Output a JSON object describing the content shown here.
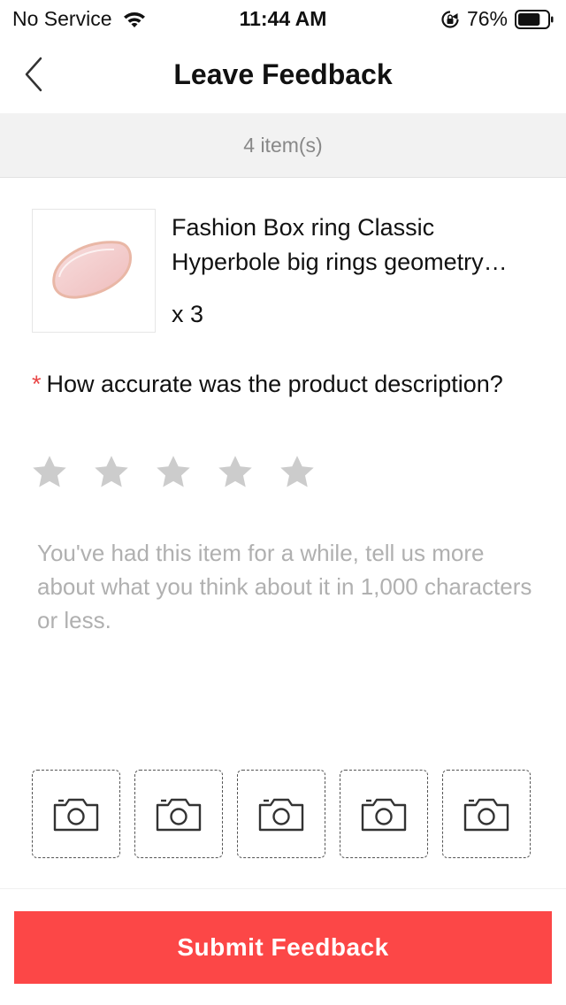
{
  "status_bar": {
    "carrier": "No Service",
    "time": "11:44 AM",
    "battery_percent": "76%",
    "wifi_icon": "wifi-icon",
    "lock_icon": "rotation-lock-icon",
    "battery_icon": "battery-icon",
    "battery_level": 0.76
  },
  "nav": {
    "title": "Leave Feedback",
    "back_icon": "chevron-left-icon"
  },
  "items": {
    "count_label": "4 item(s)"
  },
  "product": {
    "name": "Fashion Box ring Classic Hyperbole big rings geometry…",
    "quantity": "x 3"
  },
  "question": {
    "required_mark": "*",
    "text": "How accurate was the product description?",
    "rating": 0,
    "max_rating": 5,
    "star_icon": "star-icon"
  },
  "feedback": {
    "value": "",
    "placeholder": "You've had this item for a while, tell us more about what you think about it in 1,000 characters or less."
  },
  "photos": {
    "slot_count": 5,
    "icon": "camera-icon"
  },
  "submit": {
    "label": "Submit Feedback"
  },
  "colors": {
    "accent": "#fc4747",
    "required": "#e94545",
    "star_inactive": "#cccccc",
    "band_bg": "#f2f2f2"
  }
}
